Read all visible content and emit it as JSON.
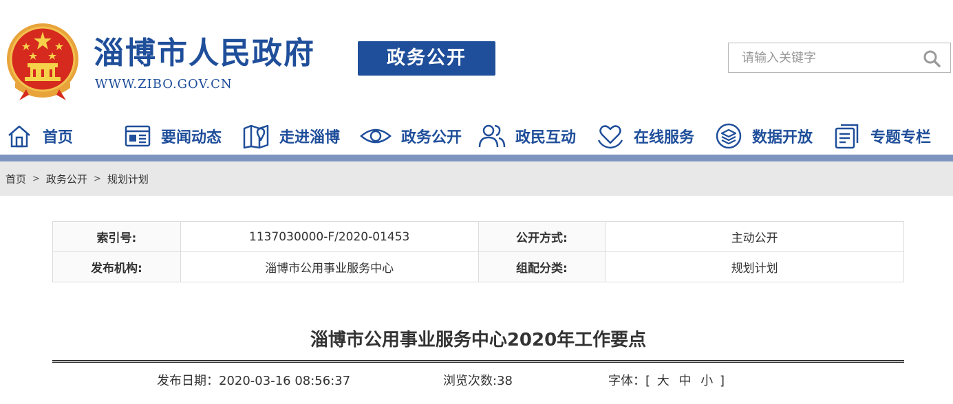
{
  "header": {
    "site_title": "淄博市人民政府",
    "site_url": "WWW.ZIBO.GOV.CN",
    "section_badge": "政务公开",
    "search": {
      "placeholder": "请输入关键字",
      "icon": "search-icon"
    },
    "emblem_icon": "national-emblem-icon"
  },
  "nav": {
    "items": [
      {
        "label": "首页",
        "icon": "home-icon"
      },
      {
        "label": "要闻动态",
        "icon": "newspaper-icon"
      },
      {
        "label": "走进淄博",
        "icon": "map-pin-icon"
      },
      {
        "label": "政务公开",
        "icon": "eye-icon"
      },
      {
        "label": "政民互动",
        "icon": "people-icon"
      },
      {
        "label": "在线服务",
        "icon": "heart-hands-icon"
      },
      {
        "label": "数据开放",
        "icon": "layers-icon"
      },
      {
        "label": "专题专栏",
        "icon": "document-stack-icon"
      }
    ],
    "accent_color": "#1f4e9a",
    "bar_color": "#7d95be"
  },
  "breadcrumb": {
    "items": [
      "首页",
      "政务公开",
      "规划计划"
    ],
    "separator": ">"
  },
  "meta": {
    "rows": [
      {
        "k1": "索引号:",
        "v1": "1137030000-F/2020-01453",
        "k2": "公开方式:",
        "v2": "主动公开"
      },
      {
        "k1": "发布机构:",
        "v1": "淄博市公用事业服务中心",
        "k2": "组配分类:",
        "v2": "规划计划"
      }
    ]
  },
  "article": {
    "title": "淄博市公用事业服务中心2020年工作要点",
    "publish_date": "发布日期：2020-03-16 08:56:37",
    "views": "浏览次数:38",
    "font_label": "字体：[",
    "font_large": "大",
    "font_medium": "中",
    "font_small": "小",
    "font_end": "]"
  }
}
